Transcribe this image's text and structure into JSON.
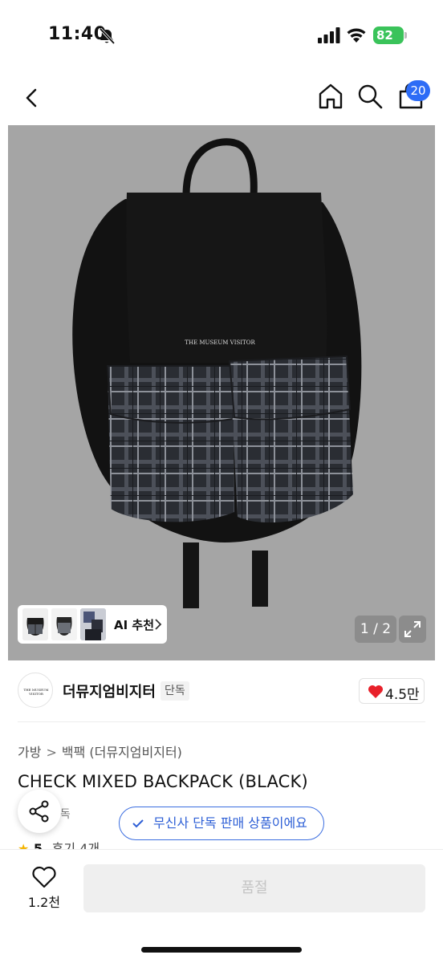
{
  "status_bar": {
    "time": "11:40",
    "battery": "82",
    "icons": [
      "bell-slash-icon",
      "signal-bars-icon",
      "wifi-icon",
      "battery-charging-icon"
    ],
    "battery_color": "#3ac35a"
  },
  "nav": {
    "icons": [
      "chevron-left-icon",
      "home-icon",
      "search-icon",
      "cart-icon"
    ],
    "cart_badge": "20",
    "badge_color": "#2d6cf6"
  },
  "gallery": {
    "background": "#a5a5a5",
    "bag_brand_print": "THE MUSEUM VISITOR",
    "ai_recommend_label": "AI 추천",
    "counter": "1 / 2",
    "expand_icon": "expand-arrows-icon",
    "thumbnails": [
      "plaid-backpack-front",
      "plaid-backpack-side",
      "model-wearing-backpack"
    ]
  },
  "brand": {
    "logo_text": "THE MUSEUM VISITOR",
    "name": "더뮤지엄비지터",
    "tag": "단독",
    "likes": "4.5만",
    "heart_color": "#e8202a"
  },
  "breadcrumb": {
    "category": "가방",
    "subcategory": "백팩 (더뮤지엄비지터)"
  },
  "product": {
    "title": "CHECK MIXED BACKPACK (BLACK)",
    "tag_partial": "단독",
    "rating": "5",
    "reviews": "후기 4개"
  },
  "exclusive_banner": {
    "text": "무신사 단독 판매 상품이에요",
    "color": "#3a6de0"
  },
  "bottom_bar": {
    "wishlist_count": "1.2천",
    "buy_button": "품절"
  }
}
